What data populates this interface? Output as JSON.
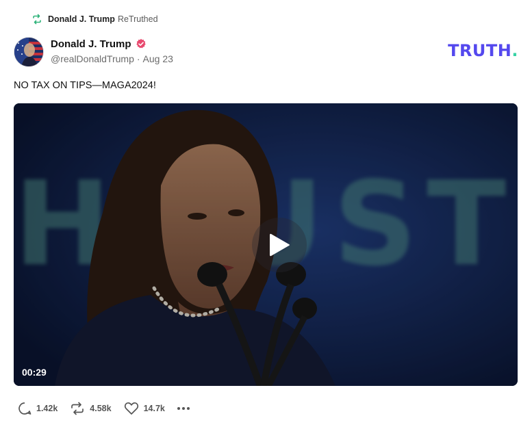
{
  "retruth": {
    "name": "Donald J. Trump",
    "label": "ReTruthed",
    "icon": "retruth-icon"
  },
  "author": {
    "display_name": "Donald J. Trump",
    "handle": "@realDonaldTrump",
    "separator": "·",
    "date": "Aug 23",
    "verified_icon": "verified-badge-icon",
    "verified_color": "#e84a6f"
  },
  "brand": {
    "logo_text": "TRUTH",
    "logo_dot": ".",
    "logo_color": "#5448ee",
    "dot_color": "#37d2a5"
  },
  "post": {
    "text": "NO TAX ON TIPS—MAGA2024!"
  },
  "video": {
    "duration": "00:29",
    "background_text": "HOUSTON.",
    "play_icon": "play-icon"
  },
  "actions": {
    "replies": {
      "icon": "reply-icon",
      "count": "1.42k"
    },
    "retruths": {
      "icon": "retruth-icon",
      "count": "4.58k"
    },
    "likes": {
      "icon": "heart-icon",
      "count": "14.7k"
    },
    "more": {
      "icon": "more-icon"
    }
  }
}
